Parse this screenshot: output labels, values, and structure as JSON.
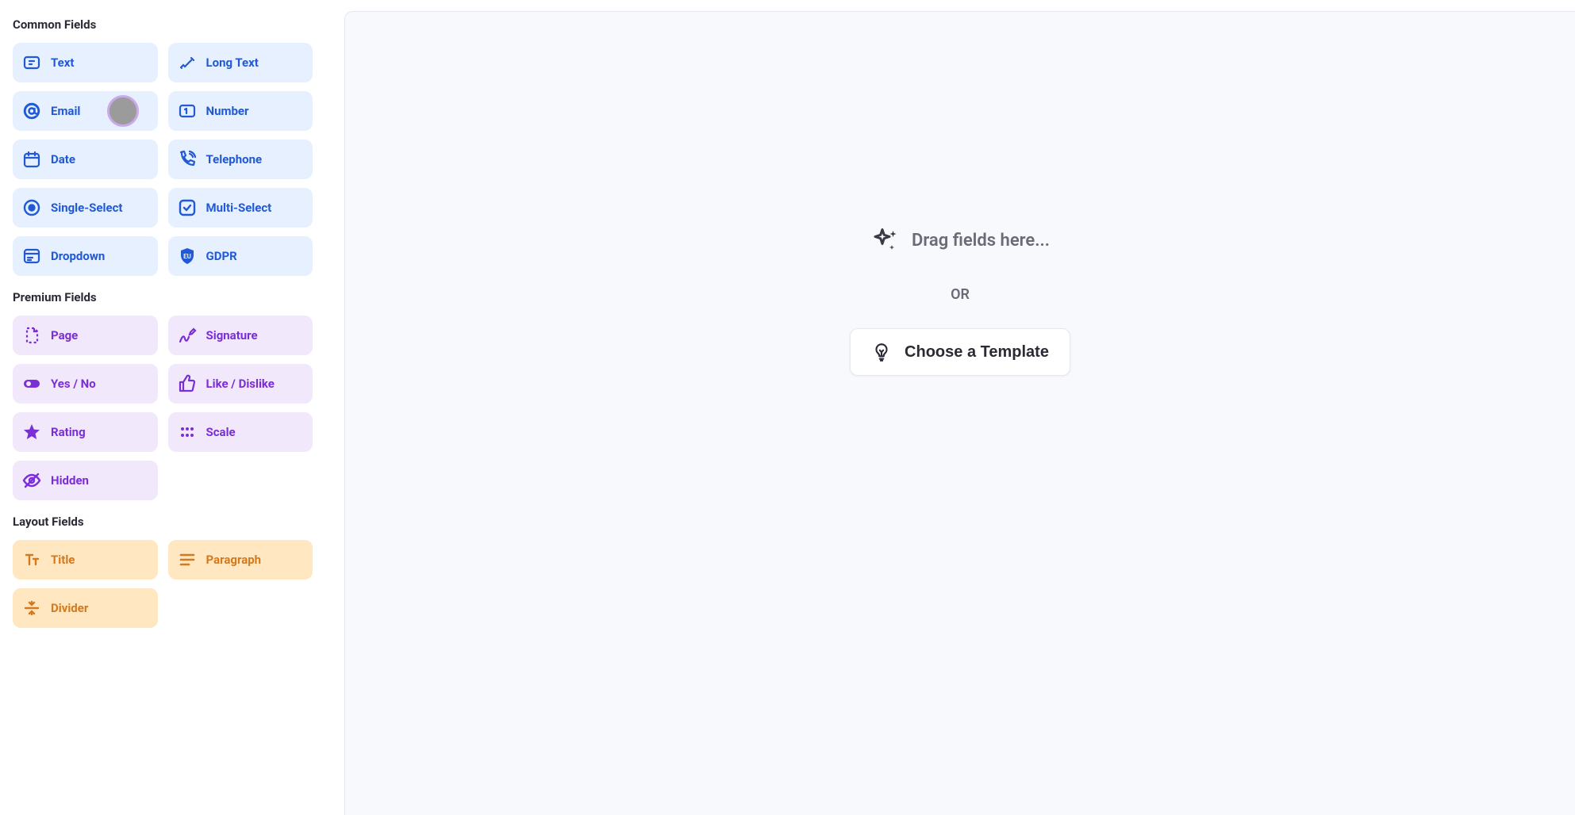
{
  "sidebar": {
    "sections": {
      "common": {
        "header": "Common Fields",
        "items": [
          {
            "label": "Text"
          },
          {
            "label": "Long Text"
          },
          {
            "label": "Email"
          },
          {
            "label": "Number"
          },
          {
            "label": "Date"
          },
          {
            "label": "Telephone"
          },
          {
            "label": "Single-Select"
          },
          {
            "label": "Multi-Select"
          },
          {
            "label": "Dropdown"
          },
          {
            "label": "GDPR"
          }
        ]
      },
      "premium": {
        "header": "Premium Fields",
        "items": [
          {
            "label": "Page"
          },
          {
            "label": "Signature"
          },
          {
            "label": "Yes / No"
          },
          {
            "label": "Like / Dislike"
          },
          {
            "label": "Rating"
          },
          {
            "label": "Scale"
          },
          {
            "label": "Hidden"
          }
        ]
      },
      "layout": {
        "header": "Layout Fields",
        "items": [
          {
            "label": "Title"
          },
          {
            "label": "Paragraph"
          },
          {
            "label": "Divider"
          }
        ]
      }
    }
  },
  "canvas": {
    "drop_hint": "Drag fields here...",
    "or_label": "OR",
    "template_button": "Choose a Template"
  }
}
